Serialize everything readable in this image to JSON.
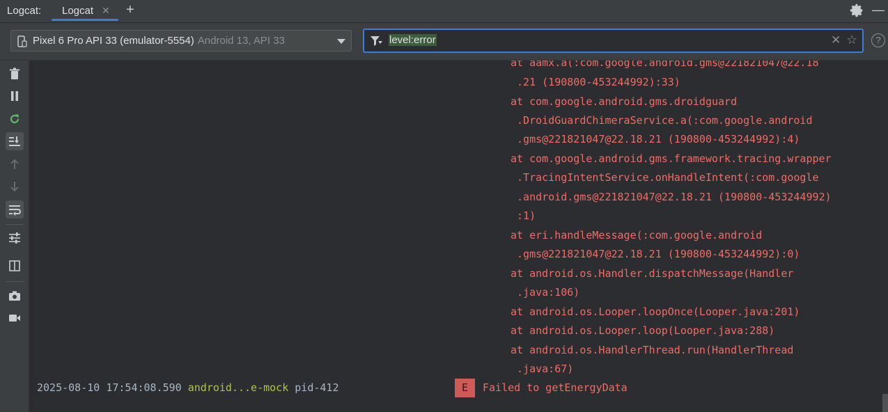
{
  "titlebar": {
    "tool_title": "Logcat:",
    "tab_label": "Logcat",
    "tab_close": "✕",
    "add_tab": "+",
    "minimize": "—"
  },
  "toolbar": {
    "device_name": "Pixel 6 Pro API 33 (emulator-5554)",
    "device_api": "Android 13, API 33",
    "filter_query": "level:error",
    "clear_glyph": "✕",
    "star_glyph": "☆",
    "help_glyph": "?"
  },
  "log": {
    "stack_lines": [
      "at aamx.a(:com.google.android.gms@221821047@22.18",
      " .21 (190800-453244992):33)",
      "at com.google.android.gms.droidguard",
      " .DroidGuardChimeraService.a(:com.google.android",
      " .gms@221821047@22.18.21 (190800-453244992):4)",
      "at com.google.android.gms.framework.tracing.wrapper",
      " .TracingIntentService.onHandleIntent(:com.google",
      " .android.gms@221821047@22.18.21 (190800-453244992)",
      " :1)",
      "at eri.handleMessage(:com.google.android",
      " .gms@221821047@22.18.21 (190800-453244992):0)",
      "at android.os.Handler.dispatchMessage(Handler",
      " .java:106)",
      "at android.os.Looper.loopOnce(Looper.java:201)",
      "at android.os.Looper.loop(Looper.java:288)",
      "at android.os.HandlerThread.run(HandlerThread",
      " .java:67)"
    ],
    "entry": {
      "timestamp": "2025-08-10 17:54:08.590",
      "tag": "android...e-mock",
      "pid": "pid-412",
      "level": "E",
      "message": "Failed to getEnergyData"
    }
  },
  "colors": {
    "accent": "#3d7dd8",
    "error_text": "#f26c64",
    "error_badge": "#cf5b56",
    "tag": "#b3c346"
  },
  "icons": [
    "gear-icon",
    "phone-icon",
    "filter-icon",
    "trash-icon",
    "pause-icon",
    "restart-icon",
    "scroll-to-end-icon",
    "up-arrow-icon",
    "down-arrow-icon",
    "soft-wrap-icon",
    "settings-sliders-icon",
    "split-view-icon",
    "camera-icon",
    "video-icon"
  ]
}
